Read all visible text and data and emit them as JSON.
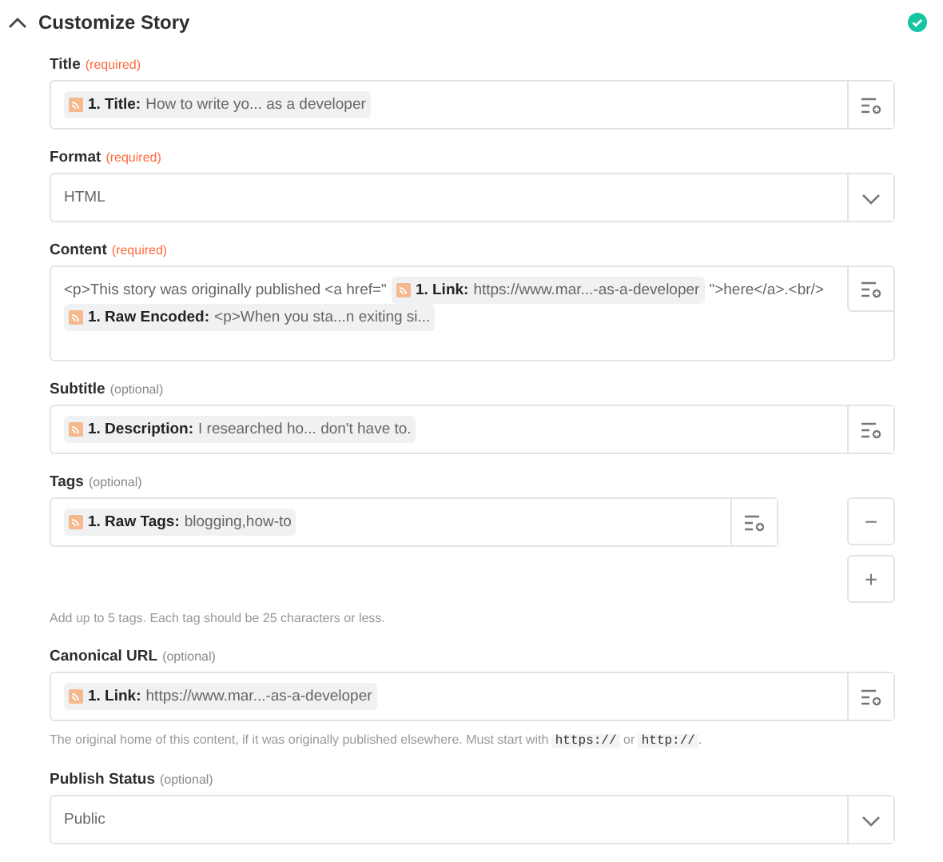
{
  "section": {
    "title": "Customize Story",
    "expanded": true,
    "complete": true
  },
  "fields": [
    {
      "kind": "mapped",
      "label": "Title",
      "required": true,
      "note": "(required)",
      "value": [
        {
          "kind": "pill",
          "key": "1. Title:",
          "text": "How to write yo... as a developer"
        }
      ]
    },
    {
      "kind": "select",
      "label": "Format",
      "required": true,
      "note": "(required)",
      "value": [
        {
          "kind": "text",
          "text": "HTML"
        }
      ]
    },
    {
      "kind": "textarea",
      "label": "Content",
      "required": true,
      "note": "(required)",
      "value": [
        {
          "kind": "text",
          "text": "<p>This story was originally published <a href=\""
        },
        {
          "kind": "pill",
          "key": "1. Link:",
          "text": "https://www.mar...-as-a-developer"
        },
        {
          "kind": "text",
          "text": "\">here</a>.<br/>"
        },
        {
          "kind": "pill",
          "key": "1. Raw Encoded:",
          "text": "<p>When you sta...n exiting si..."
        }
      ]
    },
    {
      "kind": "mapped",
      "label": "Subtitle",
      "required": false,
      "note": "(optional)",
      "value": [
        {
          "kind": "pill",
          "key": "1. Description:",
          "text": "I researched ho... don't have to."
        }
      ]
    },
    {
      "kind": "tags",
      "label": "Tags",
      "required": false,
      "note": "(optional)",
      "value": [
        {
          "kind": "pill",
          "key": "1. Raw Tags:",
          "text": "blogging,how-to"
        }
      ],
      "minus": "−",
      "plus": "+",
      "hint": [
        {
          "kind": "text",
          "text": "Add up to 5 tags. Each tag should be 25 characters or less."
        }
      ]
    },
    {
      "kind": "mapped",
      "label": "Canonical URL",
      "required": false,
      "note": "(optional)",
      "value": [
        {
          "kind": "pill",
          "key": "1. Link:",
          "text": "https://www.mar...-as-a-developer"
        }
      ],
      "hint": [
        {
          "kind": "text",
          "text": "The original home of this content, if it was originally published elsewhere. Must start with "
        },
        {
          "kind": "code",
          "text": "https://"
        },
        {
          "kind": "text",
          "text": " or "
        },
        {
          "kind": "code",
          "text": "http://"
        },
        {
          "kind": "text",
          "text": "."
        }
      ]
    },
    {
      "kind": "select",
      "label": "Publish Status",
      "required": false,
      "note": "(optional)",
      "value": [
        {
          "kind": "text",
          "text": "Public"
        }
      ]
    }
  ]
}
